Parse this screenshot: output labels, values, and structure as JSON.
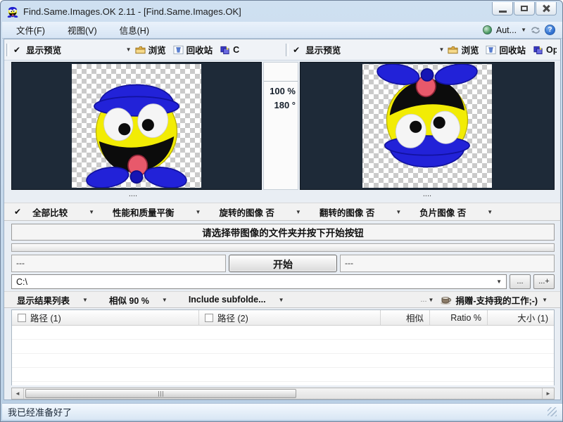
{
  "window": {
    "title": "Find.Same.Images.OK 2.11 - [Find.Same.Images.OK]"
  },
  "menu": {
    "items": [
      "文件(F)",
      "视图(V)",
      "信息(H)"
    ],
    "language": "Aut..."
  },
  "toolbar": {
    "left": {
      "preview": "显示预览",
      "browse": "浏览",
      "recycle": "回收站",
      "extra": "C"
    },
    "right": {
      "preview": "显示预览",
      "browse": "浏览",
      "recycle": "回收站",
      "extra": "Op"
    }
  },
  "preview": {
    "zoom": "100 %",
    "angle": "180 °",
    "left_caption": "....",
    "right_caption": "...."
  },
  "options": {
    "compare": "全部比较",
    "quality": "性能和质量平衡",
    "rotated": "旋转的图像 否",
    "flipped": "翻转的图像 否",
    "negative": "负片图像 否"
  },
  "message": "请选择带图像的文件夹并按下开始按钮",
  "start_row": {
    "left_field": "---",
    "start": "开始",
    "right_field": "---"
  },
  "path_row": {
    "path": "C:\\",
    "browse_btn": "...",
    "add_btn": "...+"
  },
  "filter_row": {
    "results": "显示结果列表",
    "similar": "相似 90 %",
    "subfolders": "Include subfolde...",
    "more": "...",
    "donate": "捐赠-支持我的工作;-)"
  },
  "table": {
    "columns": [
      "路径 (1)",
      "路径 (2)",
      "相似",
      "Ratio %",
      "大小 (1)"
    ]
  },
  "status": "我已经准备好了",
  "colors": {
    "panel": "#1e2a38",
    "yellow": "#f2ec04",
    "blue": "#2222d8",
    "blue2": "#1515b4",
    "tongue": "#e8596b",
    "mouth": "#0c0c0c",
    "eyewhite": "#f5f5f5",
    "help": "#2f6fd0"
  }
}
